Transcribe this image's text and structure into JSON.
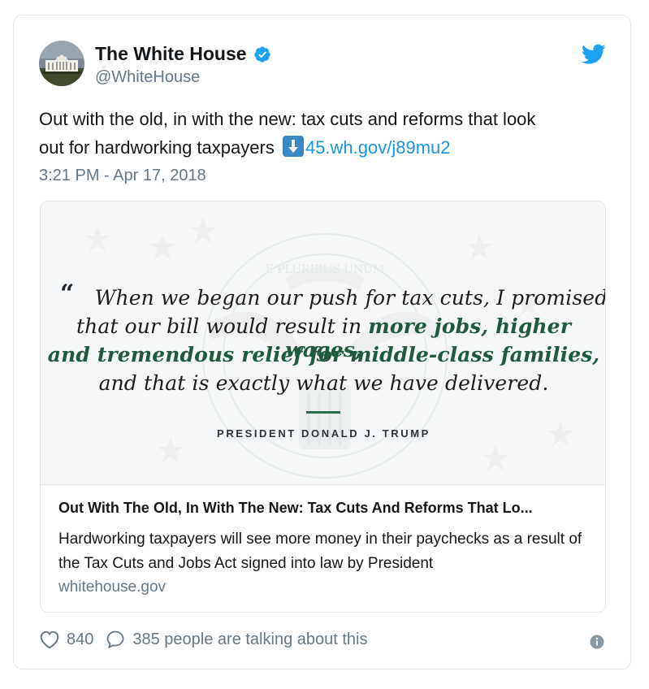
{
  "account": {
    "display_name": "The White House",
    "handle": "@WhiteHouse",
    "avatar_icon": "white-house-building-icon",
    "verified_icon": "verified-badge-icon",
    "platform_icon": "twitter-bird-icon"
  },
  "tweet": {
    "text_line1": "Out with the old, in with the new: tax cuts and reforms that look",
    "text_line2": "out for hardworking taxpayers",
    "emoji": "down-arrow-emoji",
    "link": "45.wh.gov/j89mu2",
    "timestamp": "3:21 PM - Apr 17, 2018"
  },
  "card": {
    "image": {
      "quote_mark": "“",
      "line1": "When we began our push for tax cuts, I promised",
      "line2_plain": "that our bill would result in",
      "line2_highlight": "more jobs, higher wages,",
      "line3_highlight": "and tremendous relief for middle-class families,",
      "line4": "and that is exactly what we have delivered.",
      "attribution": "PRESIDENT DONALD J. TRUMP",
      "watermark_text": "E PLURIBUS UNUM"
    },
    "title": "Out With The Old, In With The New: Tax Cuts And Reforms That Lo...",
    "description": "Hardworking taxpayers will see more money in their paychecks as a result of the Tax Cuts and Jobs Act signed into law by President",
    "domain": "whitehouse.gov"
  },
  "actions": {
    "like_count": "840",
    "conversation_text": "385 people are talking about this",
    "like_icon": "heart-icon",
    "reply_icon": "speech-bubble-icon",
    "info_icon": "info-icon"
  },
  "colors": {
    "link": "#1b95e0",
    "verified": "#1da1f2",
    "highlight_green": "#1f5a3f",
    "muted": "#657786"
  }
}
